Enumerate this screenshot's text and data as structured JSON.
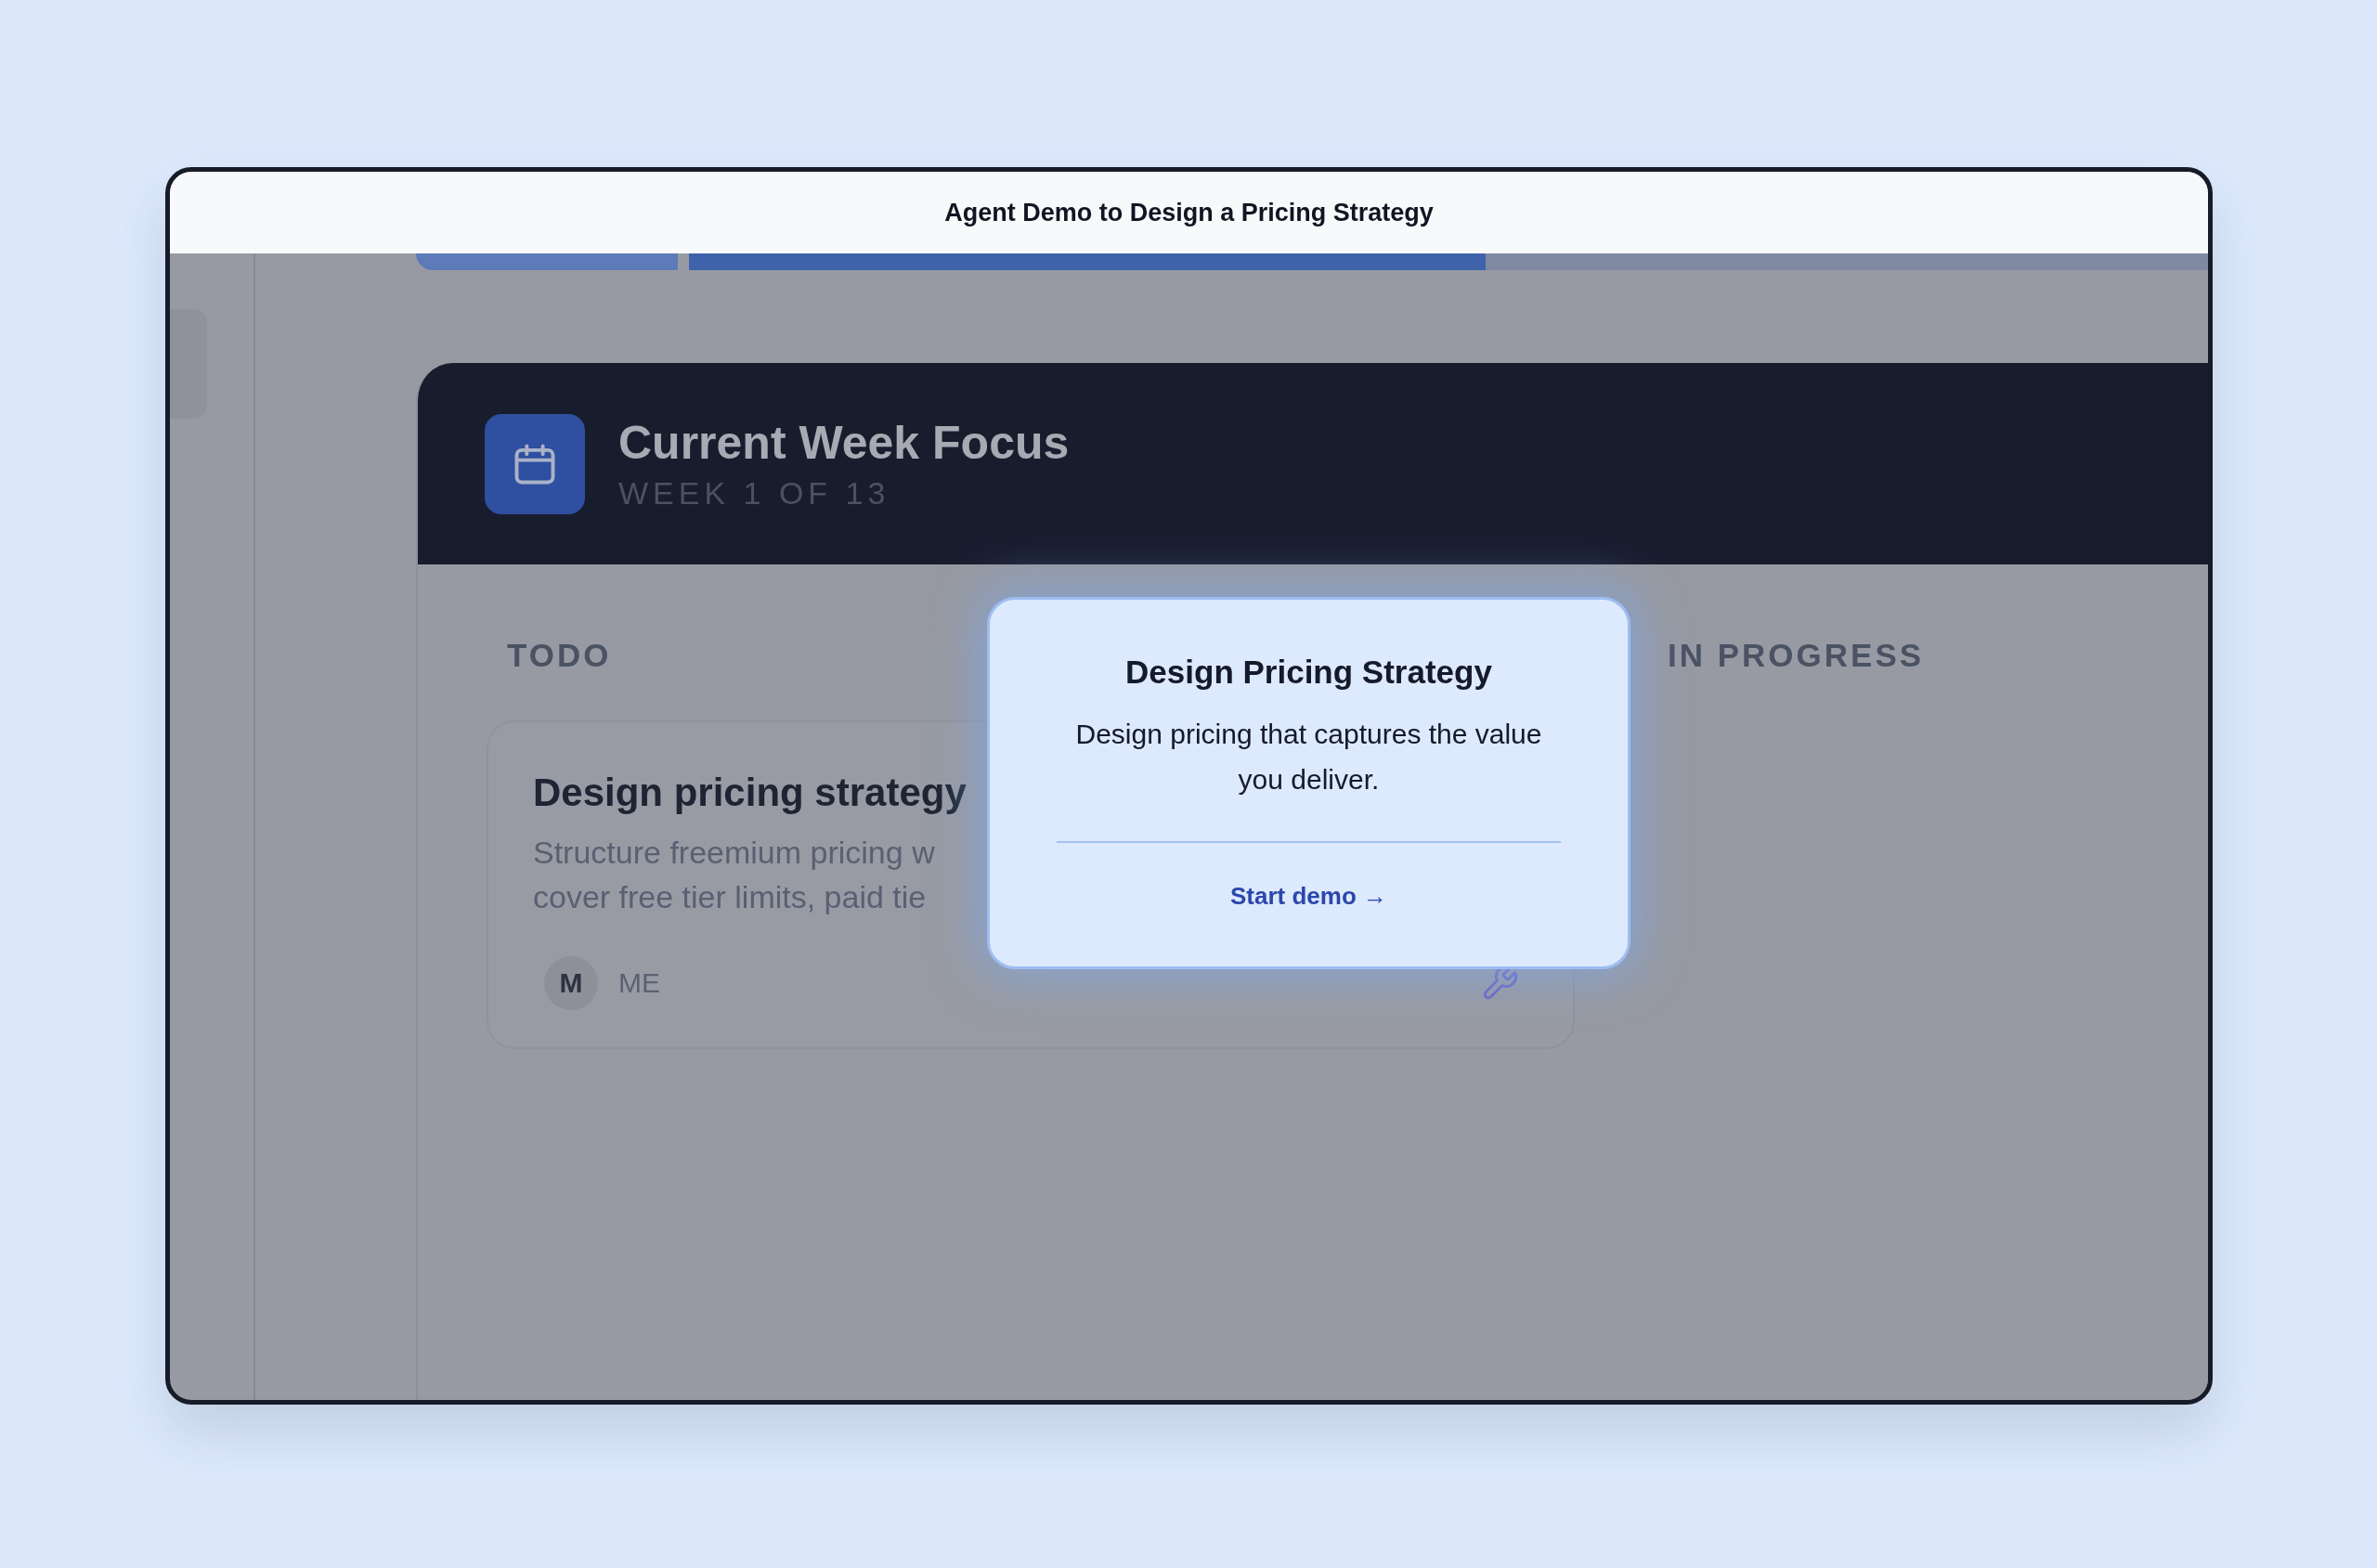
{
  "window": {
    "title": "Agent Demo to Design a Pricing Strategy"
  },
  "week_focus": {
    "title": "Current Week Focus",
    "subtitle": "WEEK 1 OF 13"
  },
  "columns": [
    {
      "heading": "TODO"
    },
    {
      "heading": "IN PROGRESS"
    }
  ],
  "task_card": {
    "title": "Design pricing strategy",
    "description_lines": [
      "Structure freemium pricing w",
      "cover free tier limits, paid tie"
    ],
    "avatar": "M",
    "assignee": "ME"
  },
  "popup": {
    "title": "Design Pricing Strategy",
    "body": "Design pricing that captures the value you deliver.",
    "link": "Start demo →"
  }
}
